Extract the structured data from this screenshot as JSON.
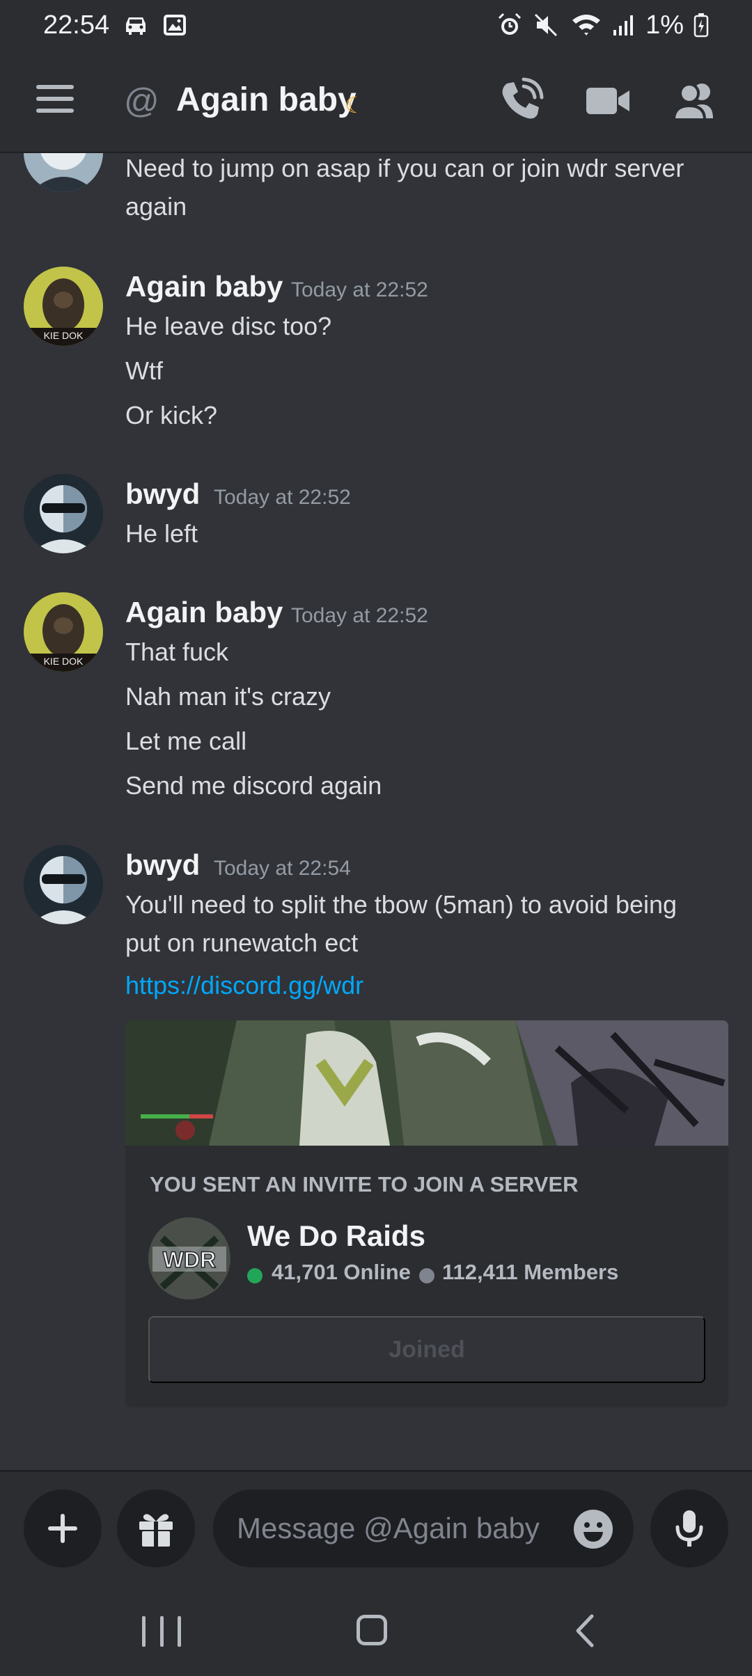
{
  "status_bar": {
    "time": "22:54",
    "battery": "1%"
  },
  "header": {
    "title": "Again baby",
    "at_symbol": "@",
    "moon_symbol": "☾"
  },
  "messages": [
    {
      "continued_lines": [
        "Need to jump on asap if you can or join wdr server",
        "again"
      ]
    },
    {
      "author": "Again baby",
      "timestamp": "Today at 22:52",
      "lines": [
        "He leave disc too?",
        "Wtf",
        "Or kick?"
      ]
    },
    {
      "author": "bwyd",
      "timestamp": "Today at 22:52",
      "lines": [
        "He left"
      ]
    },
    {
      "author": "Again baby",
      "timestamp": "Today at 22:52",
      "lines": [
        "That fuck",
        "Nah man it's crazy",
        "Let me call",
        "Send me discord again"
      ]
    },
    {
      "author": "bwyd",
      "timestamp": "Today at 22:54",
      "lines": [
        "You'll need to split the tbow (5man) to avoid being",
        "put on runewatch ect"
      ],
      "link": "https://discord.gg/wdr"
    }
  ],
  "invite": {
    "heading": "YOU SENT AN INVITE TO JOIN A SERVER",
    "server_name": "We Do Raids",
    "server_icon_text": "WDR",
    "online": "41,701 Online",
    "members": "112,411 Members",
    "button_label": "Joined"
  },
  "composer": {
    "placeholder": "Message @Again baby",
    "plus_label": "+"
  },
  "colors": {
    "background": "#313338",
    "link": "#00a8fc",
    "online": "#23a559",
    "moon": "#f0b232"
  },
  "icons": [
    "hamburger-icon",
    "at-icon",
    "moon-icon",
    "call-icon",
    "video-icon",
    "members-icon",
    "plus-icon",
    "gift-icon",
    "emoji-icon",
    "mic-icon"
  ]
}
